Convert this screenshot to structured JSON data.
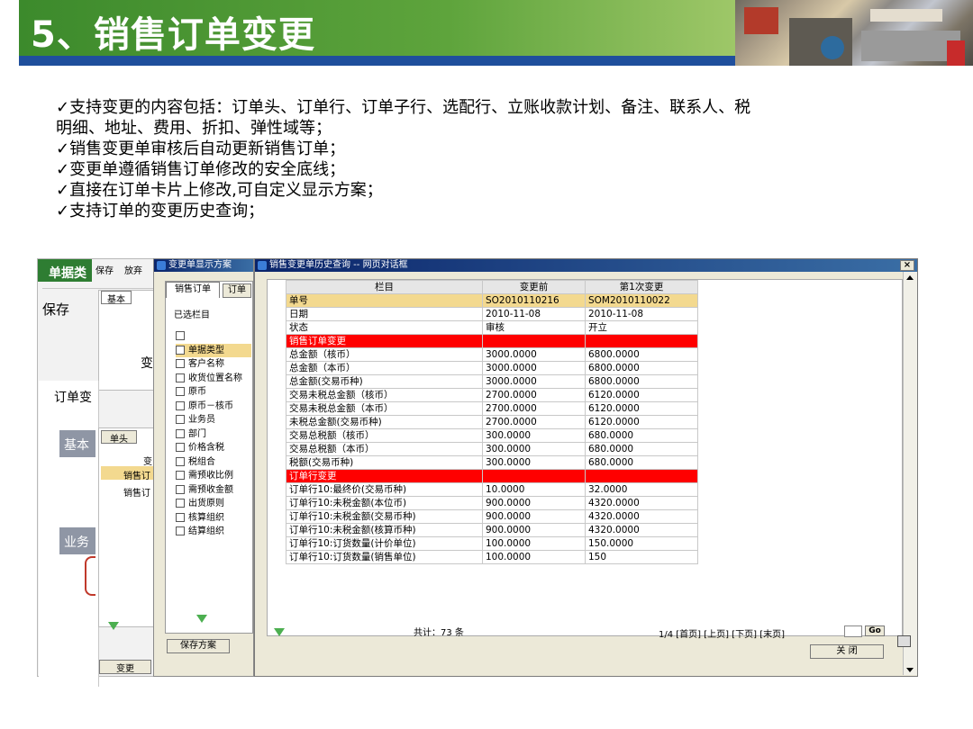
{
  "slide": {
    "title": "5、销售订单变更",
    "bullets": [
      "✓支持变更的内容包括：订单头、订单行、订单子行、选配行、立账收款计划、备注、联系人、税",
      "明细、地址、费用、折扣、弹性域等；",
      "✓销售变更单审核后自动更新销售订单；",
      "✓变更单遵循销售订单修改的安全底线；",
      "✓直接在订单卡片上修改,可自定义显示方案；",
      "✓支持订单的变更历史查询；"
    ]
  },
  "bg_window": {
    "title": "单据类",
    "toolbar": [
      "保存",
      "放弃"
    ],
    "save_big": "保存",
    "tab_basic": "基本",
    "label_bian": "变",
    "section_order": "订单变",
    "section_basic": "基本",
    "sub_tab": "单头",
    "col_bian": "变",
    "rows": [
      "销售订",
      "销售订"
    ],
    "section_yewu": "业务",
    "change_btn": "变更"
  },
  "scheme_window": {
    "title": "变更单显示方案",
    "tab_active": "销售订单",
    "tab_other": "订单",
    "selected_label": "已选栏目",
    "items": [
      "",
      "单据类型",
      "客户名称",
      "收货位置名称",
      "原币",
      "原币－核币",
      "业务员",
      "部门",
      "价格含税",
      "税组合",
      "需预收比例",
      "需预收金额",
      "出货原则",
      "核算组织",
      "结算组织"
    ],
    "save_btn": "保存方案"
  },
  "history_window": {
    "title": "销售变更单历史查询 -- 网页对话框",
    "headers": [
      "栏目",
      "变更前",
      "第1次变更"
    ],
    "rows": [
      {
        "t": "hl",
        "c": [
          "单号",
          "SO2010110216",
          "SOM2010110022"
        ]
      },
      {
        "t": "",
        "c": [
          "日期",
          "2010-11-08",
          "2010-11-08"
        ]
      },
      {
        "t": "",
        "c": [
          "状态",
          "审核",
          "开立"
        ]
      },
      {
        "t": "sec",
        "c": [
          "销售订单变更",
          "",
          ""
        ]
      },
      {
        "t": "",
        "c": [
          "总金额（核币）",
          "3000.0000",
          "6800.0000"
        ]
      },
      {
        "t": "",
        "c": [
          "总金额（本币）",
          "3000.0000",
          "6800.0000"
        ]
      },
      {
        "t": "",
        "c": [
          "总金额(交易币种)",
          "3000.0000",
          "6800.0000"
        ]
      },
      {
        "t": "",
        "c": [
          "交易未税总金额（核币）",
          "2700.0000",
          "6120.0000"
        ]
      },
      {
        "t": "",
        "c": [
          "交易未税总金额（本币）",
          "2700.0000",
          "6120.0000"
        ]
      },
      {
        "t": "",
        "c": [
          "未税总金额(交易币种)",
          "2700.0000",
          "6120.0000"
        ]
      },
      {
        "t": "",
        "c": [
          "交易总税额（核币）",
          "300.0000",
          "680.0000"
        ]
      },
      {
        "t": "",
        "c": [
          "交易总税额（本币）",
          "300.0000",
          "680.0000"
        ]
      },
      {
        "t": "",
        "c": [
          "税额(交易币种)",
          "300.0000",
          "680.0000"
        ]
      },
      {
        "t": "sec",
        "c": [
          "订单行变更",
          "",
          ""
        ]
      },
      {
        "t": "",
        "c": [
          "订单行10:最终价(交易币种)",
          "10.0000",
          "32.0000"
        ]
      },
      {
        "t": "",
        "c": [
          "订单行10:未税金额(本位币)",
          "900.0000",
          "4320.0000"
        ]
      },
      {
        "t": "",
        "c": [
          "订单行10:未税金额(交易币种)",
          "900.0000",
          "4320.0000"
        ]
      },
      {
        "t": "",
        "c": [
          "订单行10:未税金额(核算币种)",
          "900.0000",
          "4320.0000"
        ]
      },
      {
        "t": "",
        "c": [
          "订单行10:订货数量(计价单位)",
          "100.0000",
          "150.0000"
        ]
      },
      {
        "t": "",
        "c": [
          "订单行10:订货数量(销售单位)",
          "100.0000",
          "150"
        ]
      }
    ],
    "total": "共计：73 条",
    "pager": "1/4 [首页] [上页] [下页] [末页]",
    "go_btn": "Go",
    "close_btn": "关 闭",
    "win_close": "×"
  }
}
